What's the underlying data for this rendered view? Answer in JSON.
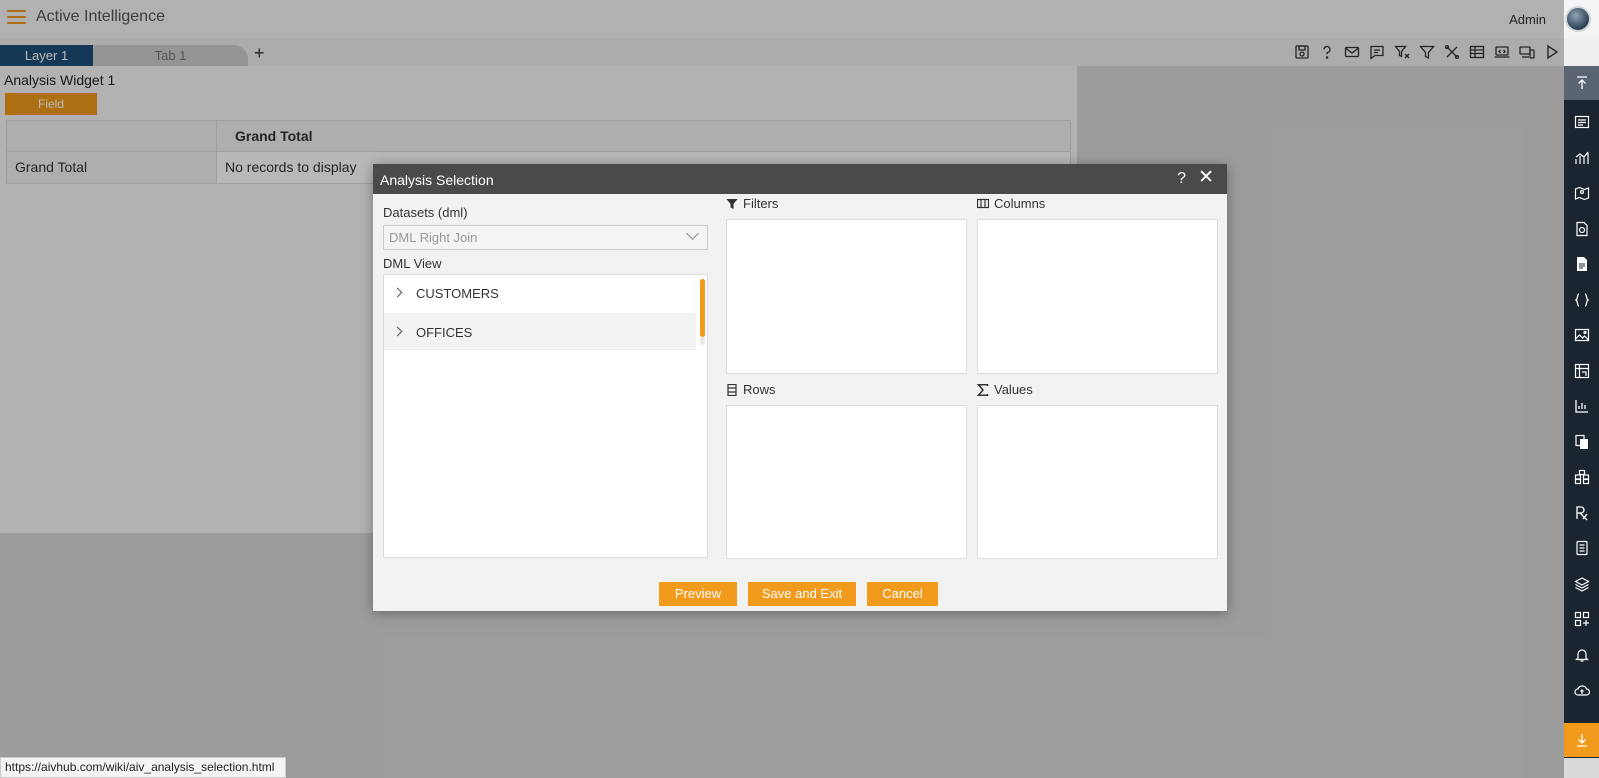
{
  "header": {
    "app_title": "Active Intelligence",
    "user_name": "Admin"
  },
  "tabs": {
    "layer": "Layer 1",
    "tab": "Tab 1",
    "add": "+"
  },
  "toolbar_icons": [
    "save-icon",
    "help-icon",
    "mail-icon",
    "comment-icon",
    "clear-filter-icon",
    "filter-icon",
    "tools-icon",
    "table-icon",
    "screen-icon",
    "devices-icon",
    "play-icon"
  ],
  "widget": {
    "title": "Analysis Widget 1",
    "field_label": "Field",
    "col_header": "Grand Total",
    "row_label": "Grand Total",
    "row_value": "No records to display"
  },
  "right_sidebar_icons": [
    "move-top-icon",
    "list-widget-icon",
    "chart-icon",
    "map-icon",
    "report-icon",
    "document-icon",
    "code-icon",
    "image-icon",
    "pivot-icon",
    "bar-chart-icon",
    "copy-icon",
    "group-icon",
    "formula-icon",
    "form-icon",
    "layers-icon",
    "add-widget-icon",
    "alert-icon",
    "upload-icon",
    "download-icon"
  ],
  "dialog": {
    "title": "Analysis Selection",
    "help": "?",
    "close": "✕",
    "datasets_label": "Datasets (dml)",
    "datasets_value": "DML Right Join",
    "dml_view_label": "DML View",
    "tree": [
      "CUSTOMERS",
      "OFFICES"
    ],
    "filters_label": "Filters",
    "columns_label": "Columns",
    "rows_label": "Rows",
    "values_label": "Values",
    "buttons": {
      "preview": "Preview",
      "save_exit": "Save and Exit",
      "cancel": "Cancel"
    }
  },
  "status_url": "https://aivhub.com/wiki/aiv_analysis_selection.html"
}
